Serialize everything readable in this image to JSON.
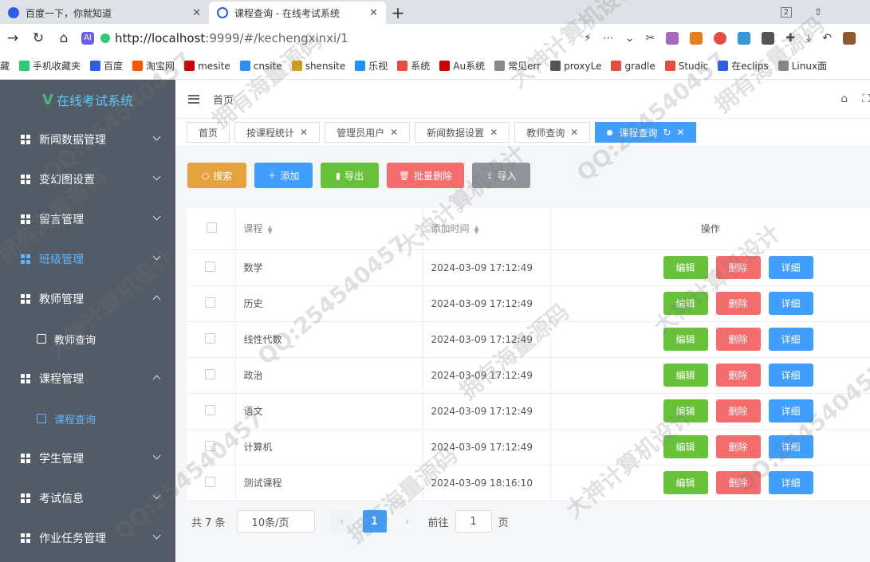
{
  "browser": {
    "tabs": [
      {
        "title": "百度一下，你就知道",
        "icon": "paw-icon",
        "close": "✕"
      },
      {
        "title": "课程查询 - 在线考试系统",
        "icon": "p-icon",
        "close": "✕"
      }
    ],
    "new_tab": "+",
    "tab_count": "2",
    "url_prefix": "http://localhost",
    "url_rest": ":9999/#/kechengxinxi/1"
  },
  "bookmarks": [
    {
      "label": "藏",
      "color": "#ffffff"
    },
    {
      "label": "手机收藏夹",
      "color": "#2ecc71"
    },
    {
      "label": "百度",
      "color": "#2c5ee8"
    },
    {
      "label": "淘宝网",
      "color": "#ff5500"
    },
    {
      "label": "mesite",
      "color": "#cc0000"
    },
    {
      "label": "cnsite",
      "color": "#2c8ef8"
    },
    {
      "label": "shensite",
      "color": "#d4a017"
    },
    {
      "label": "乐视",
      "color": "#1e90ff"
    },
    {
      "label": "系统",
      "color": "#e74c3c"
    },
    {
      "label": "Au系统",
      "color": "#cc0000"
    },
    {
      "label": "常见err",
      "color": "#888888"
    },
    {
      "label": "proxyLe",
      "color": "#555555"
    },
    {
      "label": "gradle",
      "color": "#e74c3c"
    },
    {
      "label": "Studic",
      "color": "#e74c3c"
    },
    {
      "label": "在eclips",
      "color": "#2c5ee8"
    },
    {
      "label": "Linux面",
      "color": "#888888"
    }
  ],
  "sidebar": {
    "logo": "在线考试系统",
    "logo_mark": "V",
    "items": [
      {
        "label": "新闻数据管理",
        "expanded": false,
        "active": false
      },
      {
        "label": "变幻图设置",
        "expanded": false,
        "active": false
      },
      {
        "label": "留言管理",
        "expanded": false,
        "active": false
      },
      {
        "label": "班级管理",
        "expanded": false,
        "active": true
      },
      {
        "label": "教师管理",
        "expanded": true,
        "active": false
      },
      {
        "label": "教师查询",
        "sub": true,
        "active": false
      },
      {
        "label": "课程管理",
        "expanded": true,
        "active": false
      },
      {
        "label": "课程查询",
        "sub": true,
        "active": true
      },
      {
        "label": "学生管理",
        "expanded": false,
        "active": false
      },
      {
        "label": "考试信息",
        "expanded": false,
        "active": false
      },
      {
        "label": "作业任务管理",
        "expanded": false,
        "active": false
      }
    ]
  },
  "header": {
    "breadcrumb": "首页"
  },
  "tags": [
    {
      "label": "首页",
      "closable": false,
      "current": false
    },
    {
      "label": "按课程统计",
      "closable": true,
      "current": false
    },
    {
      "label": "管理员用户",
      "closable": true,
      "current": false
    },
    {
      "label": "新闻数据设置",
      "closable": true,
      "current": false
    },
    {
      "label": "教师查询",
      "closable": true,
      "current": false
    },
    {
      "label": "课程查询",
      "closable": true,
      "current": true
    }
  ],
  "toolbar": {
    "search": "搜索",
    "add": "添加",
    "export": "导出",
    "batch_delete": "批量删除",
    "import": "导入",
    "colors": {
      "search": "#e6a23c",
      "add": "#409eff",
      "export": "#67c23a",
      "batch_delete": "#f56c6c",
      "import": "#909399"
    }
  },
  "table": {
    "columns": [
      "课程",
      "添加时间",
      "操作"
    ],
    "rows": [
      {
        "course": "数学",
        "time": "2024-03-09 17:12:49"
      },
      {
        "course": "历史",
        "time": "2024-03-09 17:12:49"
      },
      {
        "course": "线性代数",
        "time": "2024-03-09 17:12:49"
      },
      {
        "course": "政治",
        "time": "2024-03-09 17:12:49"
      },
      {
        "course": "语文",
        "time": "2024-03-09 17:12:49"
      },
      {
        "course": "计算机",
        "time": "2024-03-09 17:12:49"
      },
      {
        "course": "测试课程",
        "time": "2024-03-09 18:16:10"
      }
    ],
    "actions": {
      "edit": "编辑",
      "delete": "删除",
      "detail": "详细"
    },
    "action_colors": {
      "edit": "#67c23a",
      "delete": "#f56c6c",
      "detail": "#409eff"
    }
  },
  "pagination": {
    "total": "共 7 条",
    "page_size": "10条/页",
    "current_page": "1",
    "goto_label": "前往",
    "goto_value": "1",
    "page_suffix": "页"
  },
  "watermarks": [
    "QQ:254540457",
    "拥有海量源码",
    "大神计算机设计"
  ]
}
